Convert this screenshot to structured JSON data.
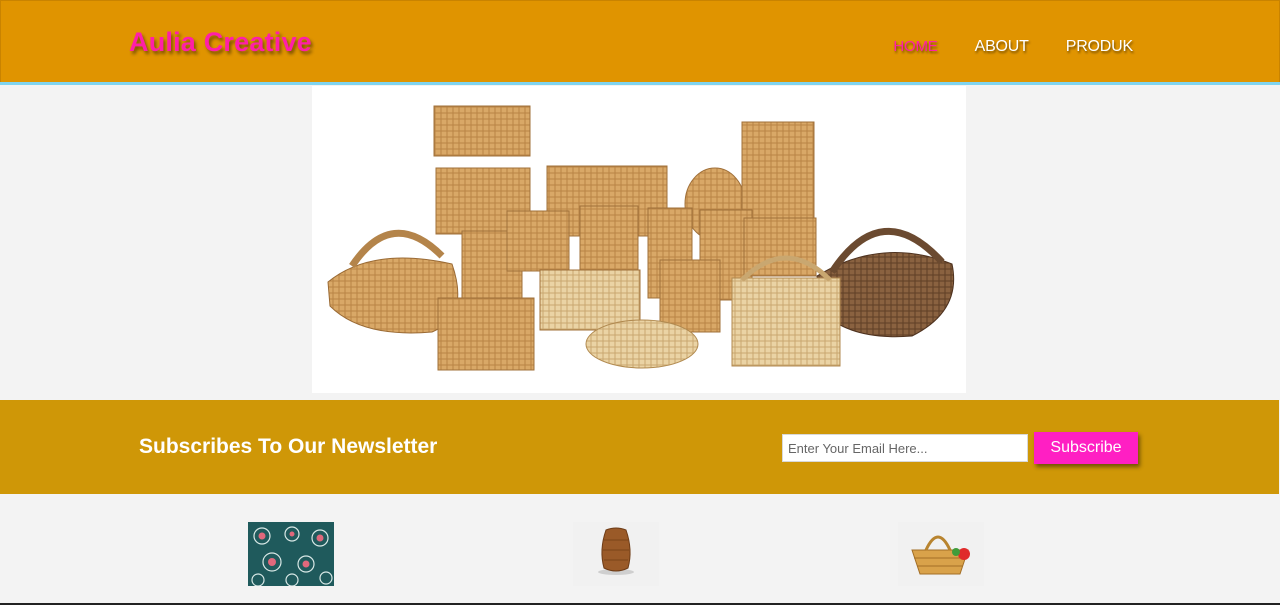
{
  "header": {
    "logo": "Aulia Creative",
    "nav": [
      {
        "label": "HOME",
        "active": true
      },
      {
        "label": "ABOUT",
        "active": false
      },
      {
        "label": "PRODUK",
        "active": false
      }
    ]
  },
  "hero": {
    "image": "rattan-baskets-collection"
  },
  "newsletter": {
    "title": "Subscribes To Our Newsletter",
    "email_placeholder": "Enter Your Email Here...",
    "button_label": "Subscribe"
  },
  "products": [
    {
      "image": "batik-fabric"
    },
    {
      "image": "rattan-vase"
    },
    {
      "image": "rattan-basket-flowers"
    }
  ],
  "colors": {
    "header": "#e09400",
    "accent_pink": "#ff1fa8",
    "newsletter_bg": "#cf9707",
    "button": "#ff1fc3",
    "header_line": "#7fd4f0"
  }
}
